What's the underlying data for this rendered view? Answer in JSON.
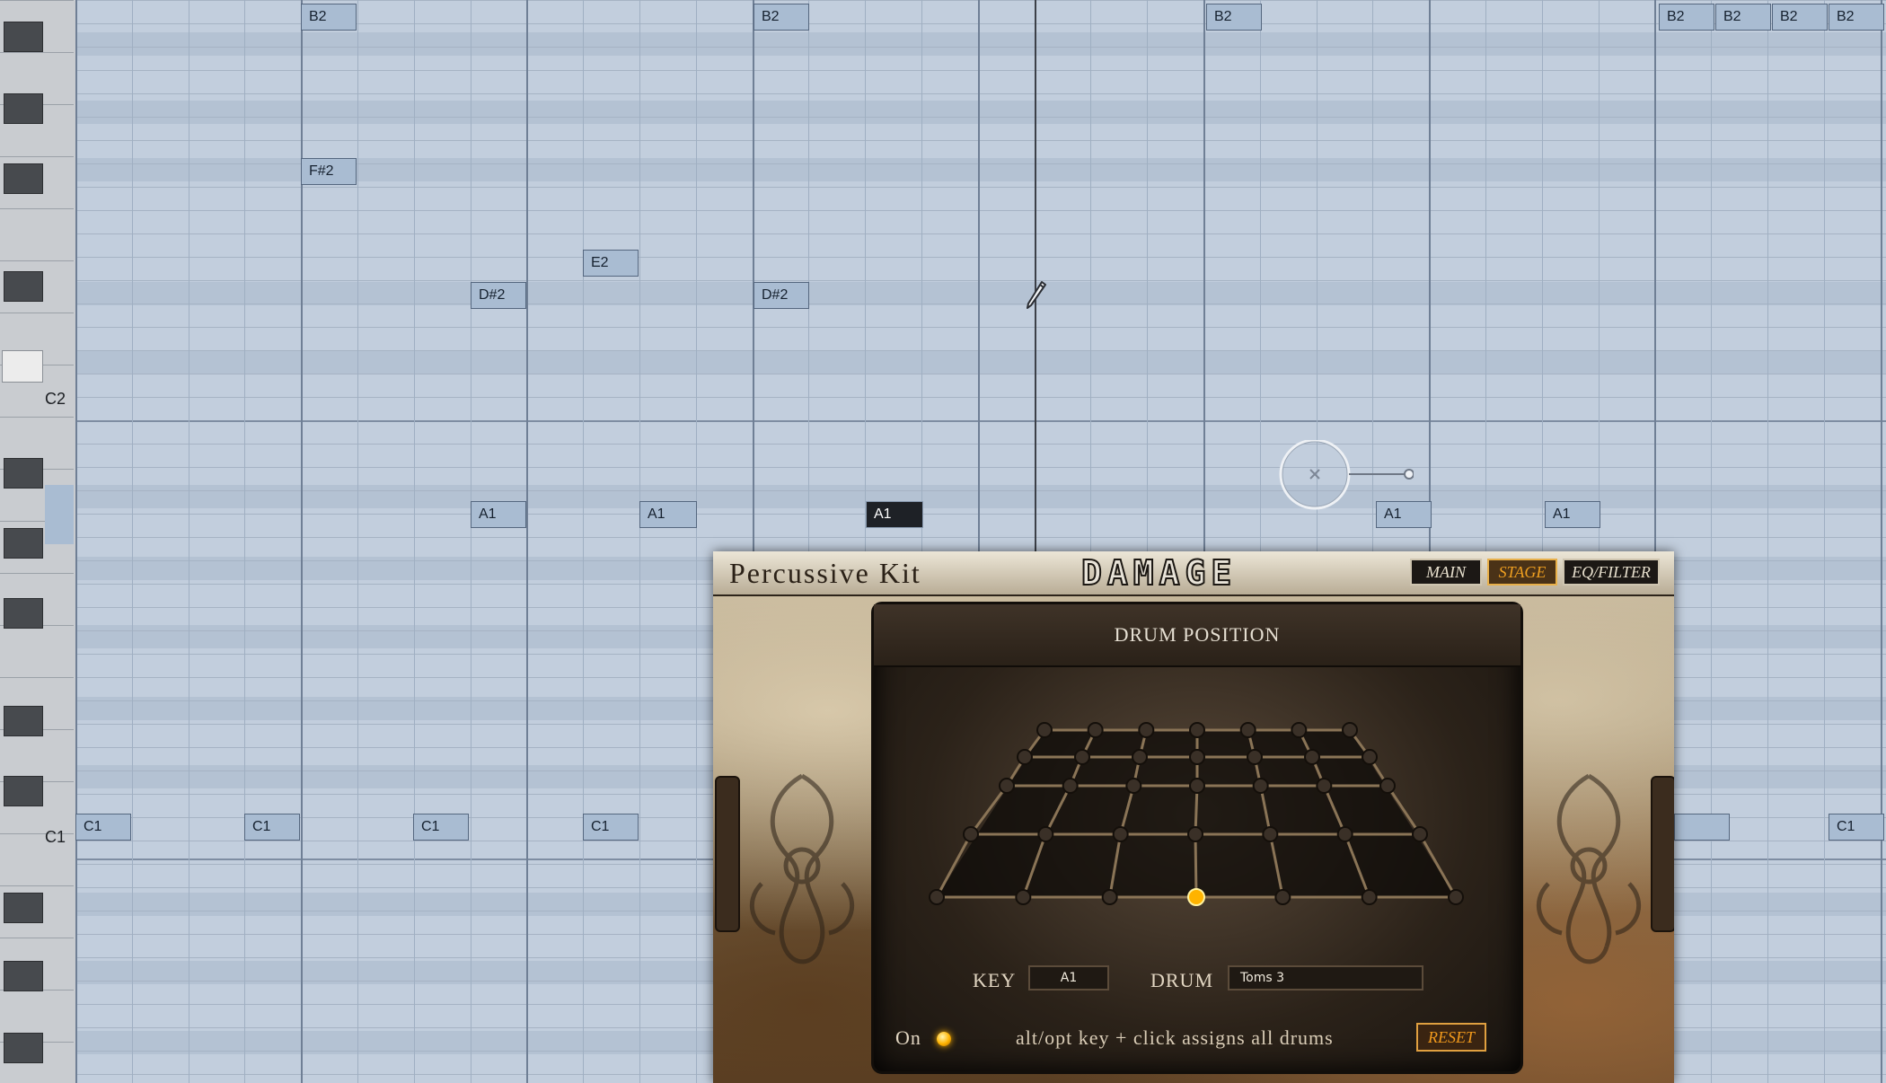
{
  "piano_roll": {
    "octave_labels": [
      {
        "label": "C2"
      },
      {
        "label": "C1"
      }
    ],
    "notes": [
      {
        "label": "B2",
        "selected": false
      },
      {
        "label": "B2",
        "selected": false
      },
      {
        "label": "B2",
        "selected": false
      },
      {
        "label": "B2",
        "selected": false
      },
      {
        "label": "B2",
        "selected": false
      },
      {
        "label": "B2",
        "selected": false
      },
      {
        "label": "B2",
        "selected": false
      },
      {
        "label": "F#2",
        "selected": false
      },
      {
        "label": "E2",
        "selected": false
      },
      {
        "label": "D#2",
        "selected": false
      },
      {
        "label": "D#2",
        "selected": false
      },
      {
        "label": "A1",
        "selected": false
      },
      {
        "label": "A1",
        "selected": false
      },
      {
        "label": "A1",
        "selected": true
      },
      {
        "label": "A1",
        "selected": false
      },
      {
        "label": "A1",
        "selected": false
      },
      {
        "label": "C1",
        "selected": false
      },
      {
        "label": "C1",
        "selected": false
      },
      {
        "label": "C1",
        "selected": false
      },
      {
        "label": "C1",
        "selected": false
      },
      {
        "label": "C1",
        "selected": false
      },
      {
        "label": "",
        "selected": false
      }
    ]
  },
  "plugin": {
    "title": "Percussive Kit",
    "logo": "DAMAGE",
    "tabs": [
      {
        "label": "MAIN",
        "active": false
      },
      {
        "label": "STAGE",
        "active": true
      },
      {
        "label": "EQ/FILTER",
        "active": false
      }
    ],
    "panel_title": "DRUM POSITION",
    "key_label": "KEY",
    "key_value": "A1",
    "drum_label": "DRUM",
    "drum_value": "Toms 3",
    "on_label": "On",
    "hint": "alt/opt key + click assigns all drums",
    "reset_label": "RESET",
    "active_color": "#ffb300"
  }
}
